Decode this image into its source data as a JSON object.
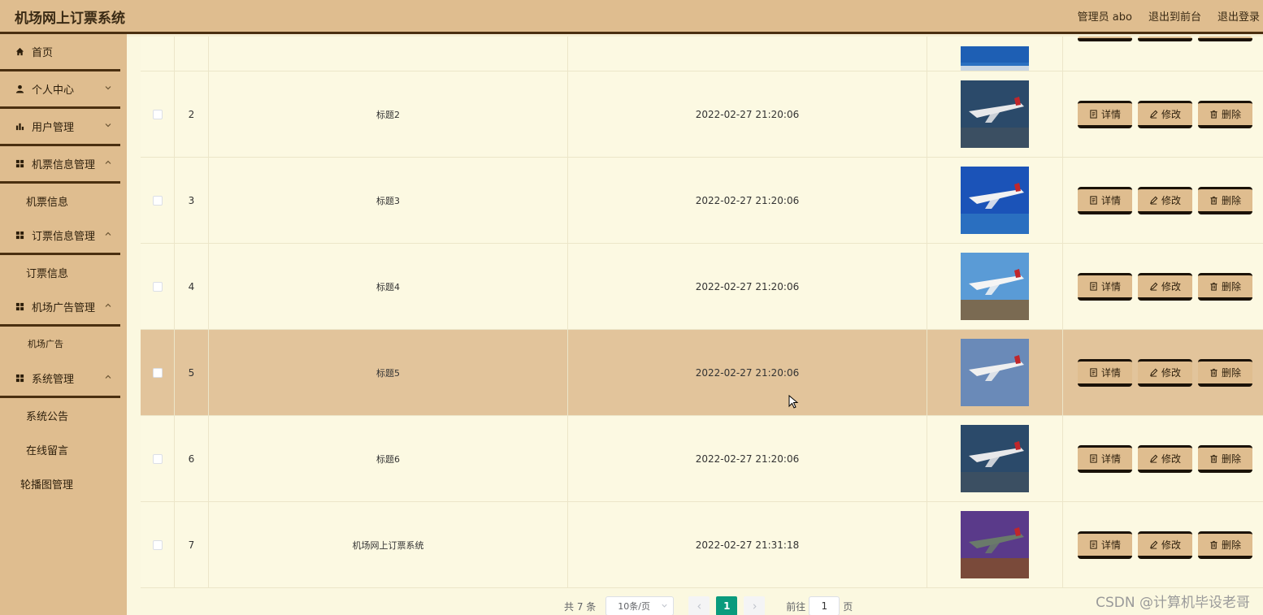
{
  "header": {
    "title": "机场网上订票系统",
    "admin": "管理员 abo",
    "front": "退出到前台",
    "logout": "退出登录"
  },
  "sidebar": {
    "home": "首页",
    "personal": "个人中心",
    "users": "用户管理",
    "ticket_mgmt": "机票信息管理",
    "ticket_info": "机票信息",
    "order_mgmt": "订票信息管理",
    "order_info": "订票信息",
    "ad_mgmt": "机场广告管理",
    "ad": "机场广告",
    "system": "系统管理",
    "notice": "系统公告",
    "message": "在线留言",
    "carousel": "轮播图管理"
  },
  "table": {
    "rows": [
      {
        "idx": "2",
        "title": "标题2",
        "time": "2022-02-27 21:20:06"
      },
      {
        "idx": "3",
        "title": "标题3",
        "time": "2022-02-27 21:20:06"
      },
      {
        "idx": "4",
        "title": "标题4",
        "time": "2022-02-27 21:20:06"
      },
      {
        "idx": "5",
        "title": "标题5",
        "time": "2022-02-27 21:20:06"
      },
      {
        "idx": "6",
        "title": "标题6",
        "time": "2022-02-27 21:20:06"
      },
      {
        "idx": "7",
        "title": "机场网上订票系统",
        "time": "2022-02-27 21:31:18"
      }
    ],
    "ops": {
      "detail": "详情",
      "edit": "修改",
      "delete": "删除"
    }
  },
  "pagination": {
    "total": "共 7 条",
    "page_size": "10条/页",
    "current": "1",
    "goto_prefix": "前往",
    "goto_value": "1",
    "goto_suffix": "页"
  },
  "watermark": "CSDN @计算机毕设老哥",
  "colors": {
    "header_bg": "#dfbd8f",
    "content_bg": "#fbf8e0",
    "highlight_row": "#e2c49b",
    "active_page": "#0a9b7d",
    "dark_border": "#4a2f10"
  }
}
